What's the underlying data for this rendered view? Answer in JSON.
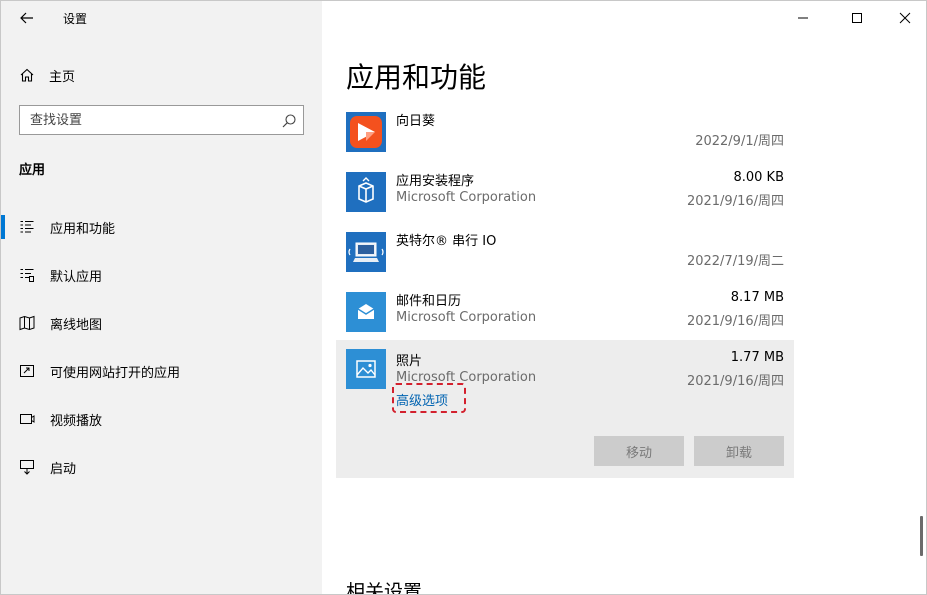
{
  "window": {
    "title": "设置"
  },
  "sidebar": {
    "home_label": "主页",
    "search_placeholder": "查找设置",
    "section_heading": "应用",
    "items": [
      {
        "label": "应用和功能",
        "icon": "apps-features-icon",
        "active": true
      },
      {
        "label": "默认应用",
        "icon": "default-apps-icon",
        "active": false
      },
      {
        "label": "离线地图",
        "icon": "offline-maps-icon",
        "active": false
      },
      {
        "label": "可使用网站打开的应用",
        "icon": "apps-for-websites-icon",
        "active": false
      },
      {
        "label": "视频播放",
        "icon": "video-playback-icon",
        "active": false
      },
      {
        "label": "启动",
        "icon": "startup-icon",
        "active": false
      }
    ]
  },
  "main": {
    "title": "应用和功能",
    "apps": [
      {
        "name": "向日葵",
        "publisher": "",
        "size": "",
        "date": "2022/9/1/周四",
        "icon": "sunlogin-icon"
      },
      {
        "name": "应用安装程序",
        "publisher": "Microsoft Corporation",
        "size": "8.00 KB",
        "date": "2021/9/16/周四",
        "icon": "app-installer-icon"
      },
      {
        "name": "英特尔® 串行 IO",
        "publisher": "",
        "size": "",
        "date": "2022/7/19/周二",
        "icon": "intel-serial-io-icon"
      },
      {
        "name": "邮件和日历",
        "publisher": "Microsoft Corporation",
        "size": "8.17 MB",
        "date": "2021/9/16/周四",
        "icon": "mail-calendar-icon"
      }
    ],
    "selected_app": {
      "name": "照片",
      "publisher": "Microsoft Corporation",
      "size": "1.77 MB",
      "date": "2021/9/16/周四",
      "icon": "photos-icon",
      "advanced_options": "高级选项",
      "move_label": "移动",
      "uninstall_label": "卸载"
    },
    "related_settings_heading": "相关设置"
  },
  "colors": {
    "accent": "#0078d4",
    "link": "#0063b1",
    "highlight_annotation": "#d3202d",
    "sidebar_bg": "#f2f2f2",
    "tile_blue": "#1f6fbf"
  }
}
